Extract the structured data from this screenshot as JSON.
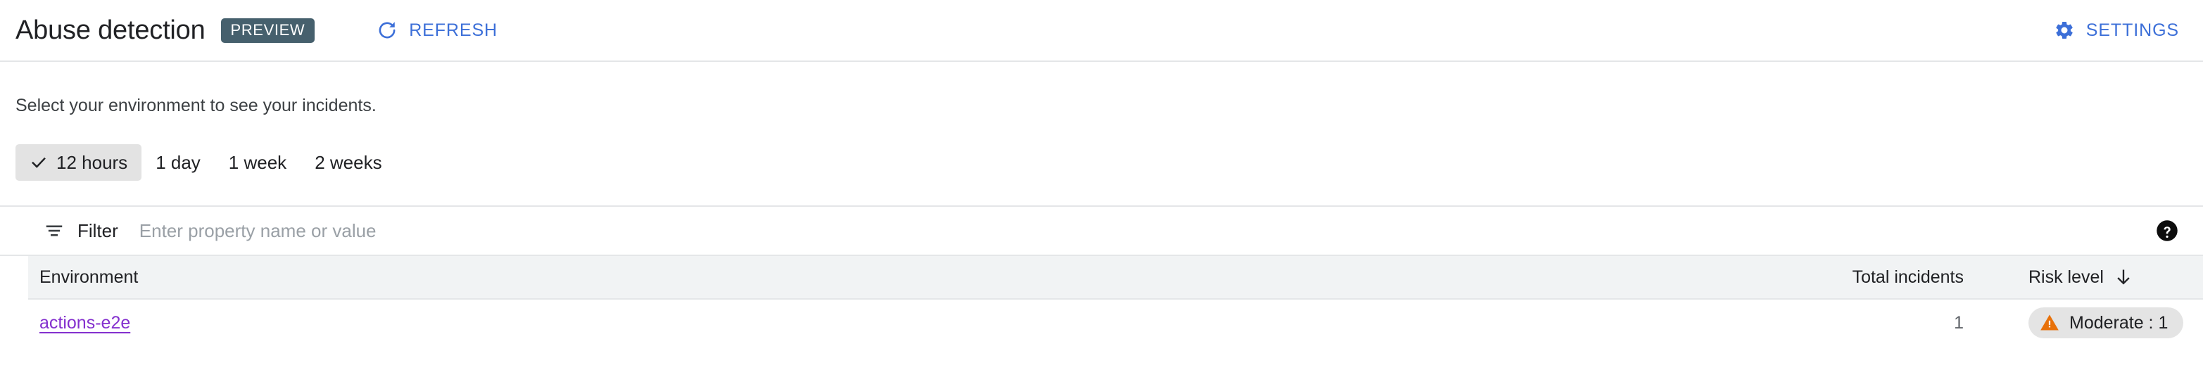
{
  "header": {
    "title": "Abuse detection",
    "preview_badge": "PREVIEW",
    "preview_badge_color": "#46606d",
    "refresh_label": "REFRESH",
    "refresh_icon": "refresh-icon",
    "settings_label": "SETTINGS",
    "settings_icon": "gear-icon",
    "action_color": "#3c6fd8"
  },
  "subtitle": "Select your environment to see your incidents.",
  "time_range": {
    "selected": "12 hours",
    "check_icon": "check-icon",
    "options": [
      {
        "label": "12 hours",
        "selected": true
      },
      {
        "label": "1 day",
        "selected": false
      },
      {
        "label": "1 week",
        "selected": false
      },
      {
        "label": "2 weeks",
        "selected": false
      }
    ]
  },
  "filter": {
    "icon": "filter-icon",
    "label": "Filter",
    "placeholder": "Enter property name or value",
    "value": "",
    "help_icon": "help-icon"
  },
  "table": {
    "columns": {
      "environment": "Environment",
      "total_incidents": "Total incidents",
      "risk_level": "Risk level"
    },
    "sort": {
      "column": "Risk level",
      "direction": "descending",
      "icon": "arrow-downward-icon"
    },
    "rows": [
      {
        "environment": "actions-e2e",
        "environment_link_color": "#8430ce",
        "total_incidents": "1",
        "risk_icon": "warning-triangle-icon",
        "risk_label": "Moderate : 1",
        "risk_icon_color": "#e8710a"
      }
    ]
  }
}
